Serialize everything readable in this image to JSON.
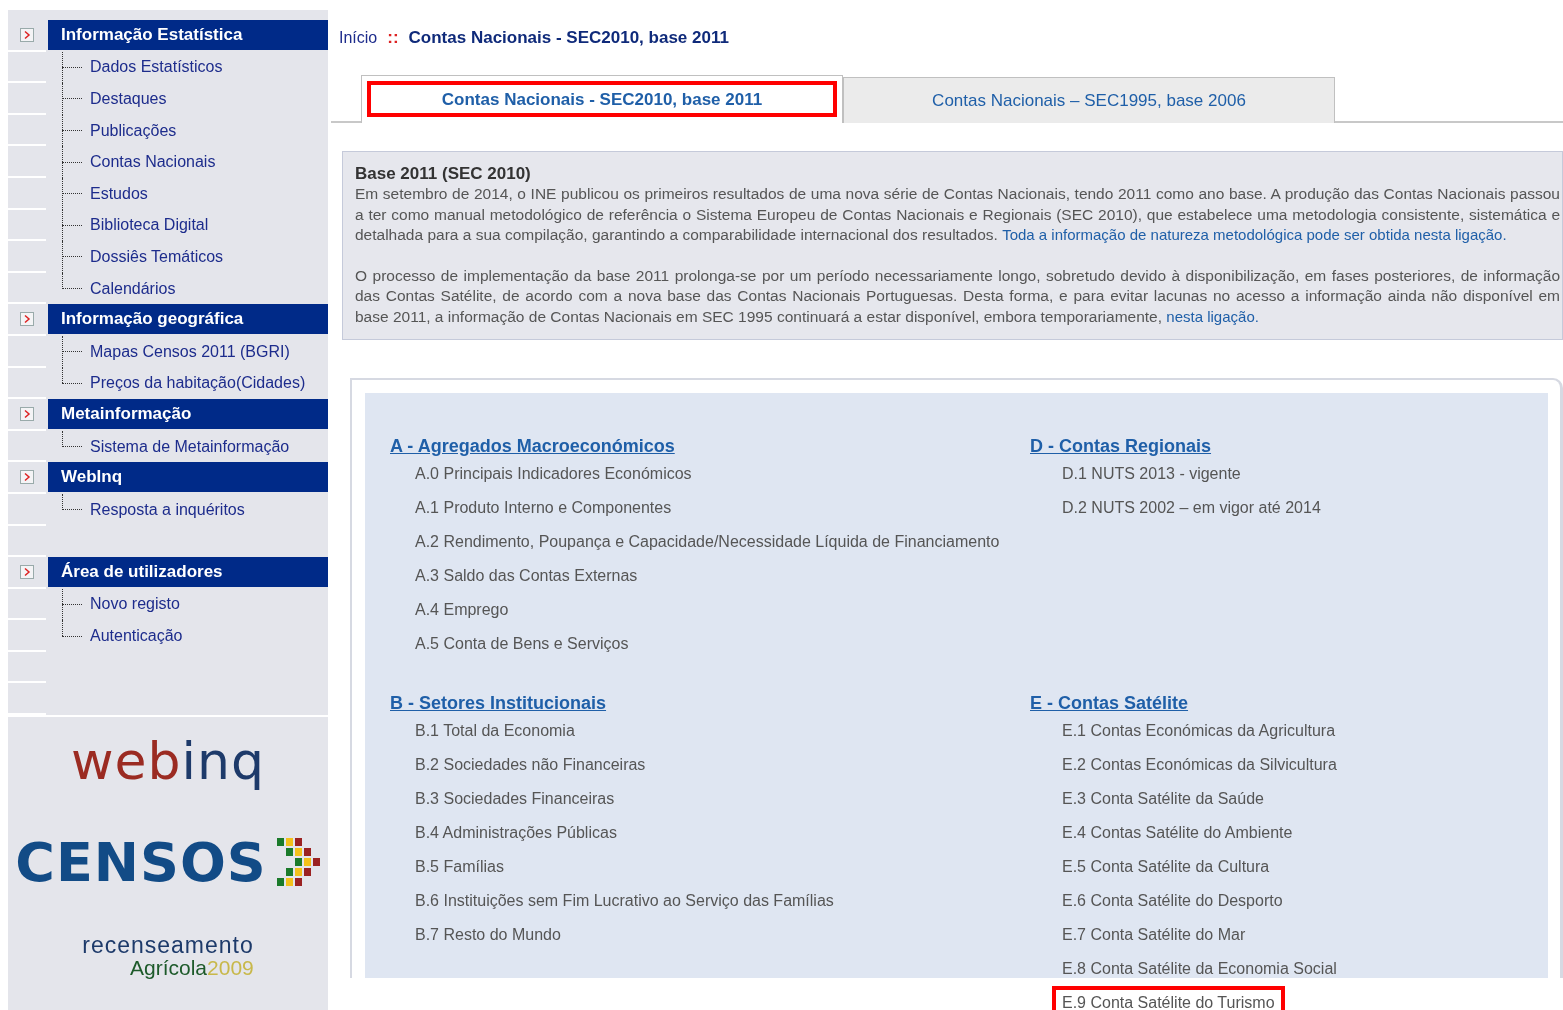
{
  "sidebar": {
    "groups": [
      {
        "title": "Informação Estatística",
        "items": [
          "Dados Estatísticos",
          "Destaques",
          "Publicações",
          "Contas Nacionais",
          "Estudos",
          "Biblioteca Digital",
          "Dossiês Temáticos",
          "Calendários"
        ]
      },
      {
        "title": "Informação geográfica",
        "items": [
          "Mapas Censos 2011 (BGRI)",
          "Preços da habitação(Cidades)"
        ]
      },
      {
        "title": "Metainformação",
        "items": [
          "Sistema de Metainformação"
        ]
      },
      {
        "title": "WebInq",
        "items": [
          "Resposta a inquéritos"
        ]
      },
      {
        "title": "Área de utilizadores",
        "items": [
          "Novo registo",
          "Autenticação"
        ]
      }
    ],
    "logos": [
      {
        "kind": "webinq",
        "parts": [
          "web",
          "inq"
        ]
      },
      {
        "kind": "censos",
        "parts": [
          "CENSOS"
        ]
      },
      {
        "kind": "agricola",
        "parts": [
          "recenseamento",
          "Agrícola",
          "2009"
        ]
      }
    ]
  },
  "breadcrumb": {
    "home": "Início",
    "separator": "::",
    "current": "Contas Nacionais - SEC2010, base 2011"
  },
  "tabs": [
    {
      "label": "Contas Nacionais - SEC2010, base 2011",
      "selected": true,
      "highlighted": true
    },
    {
      "label": "Contas Nacionais – SEC1995, base 2006",
      "selected": false,
      "highlighted": false
    }
  ],
  "intro": {
    "title": "Base 2011 (SEC 2010)",
    "paragraphs": [
      {
        "text": "Em setembro de 2014, o INE publicou os primeiros resultados de uma nova série de Contas Nacionais, tendo 2011 como ano base. A produção das Contas Nacionais passou a ter como manual metodológico de referência o Sistema Europeu de Contas Nacionais e Regionais (SEC 2010), que estabelece uma metodologia consistente, sistemática e detalhada para a sua compilação, garantindo a comparabilidade internacional dos resultados.",
        "link": "Toda a informação de natureza metodológica pode ser obtida nesta ligação."
      },
      {
        "text": "O processo de implementação da base 2011 prolonga-se por um período necessariamente longo, sobretudo devido à disponibilização, em fases posteriores, de informação das Contas Satélite, de acordo com a nova base das Contas Nacionais Portuguesas. Desta forma, e para evitar lacunas no acesso a informação ainda não disponível em base 2011, a informação de Contas Nacionais em SEC 1995 continuará a estar disponível, embora temporariamente,",
        "link": "nesta ligação."
      }
    ]
  },
  "sections": [
    {
      "title": "A - Agregados Macroeconómicos",
      "items": [
        {
          "label": "A.0 Principais Indicadores Económicos",
          "highlighted": false
        },
        {
          "label": "A.1 Produto Interno e Componentes",
          "highlighted": false
        },
        {
          "label": "A.2 Rendimento, Poupança e Capacidade/Necessidade Líquida de Financiamento",
          "highlighted": false
        },
        {
          "label": "A.3 Saldo das Contas Externas",
          "highlighted": false
        },
        {
          "label": "A.4 Emprego",
          "highlighted": false
        },
        {
          "label": "A.5 Conta de Bens e Serviços",
          "highlighted": false
        }
      ]
    },
    {
      "title": "D - Contas Regionais",
      "items": [
        {
          "label": "D.1 NUTS 2013 - vigente",
          "highlighted": false
        },
        {
          "label": "D.2 NUTS 2002 – em vigor até 2014",
          "highlighted": false
        }
      ]
    },
    {
      "title": "B - Setores Institucionais",
      "items": [
        {
          "label": "B.1 Total da Economia",
          "highlighted": false
        },
        {
          "label": "B.2 Sociedades não Financeiras",
          "highlighted": false
        },
        {
          "label": "B.3 Sociedades Financeiras",
          "highlighted": false
        },
        {
          "label": "B.4 Administrações Públicas",
          "highlighted": false
        },
        {
          "label": "B.5 Famílias",
          "highlighted": false
        },
        {
          "label": "B.6 Instituições sem Fim Lucrativo ao Serviço das Famílias",
          "highlighted": false
        },
        {
          "label": "B.7 Resto do Mundo",
          "highlighted": false
        }
      ]
    },
    {
      "title": "E - Contas Satélite",
      "items": [
        {
          "label": "E.1 Contas Económicas da Agricultura",
          "highlighted": false
        },
        {
          "label": "E.2 Contas Económicas da Silvicultura",
          "highlighted": false
        },
        {
          "label": "E.3 Conta Satélite da Saúde",
          "highlighted": false
        },
        {
          "label": "E.4 Contas Satélite do Ambiente",
          "highlighted": false
        },
        {
          "label": "E.5 Conta Satélite da Cultura",
          "highlighted": false
        },
        {
          "label": "E.6 Conta Satélite do Desporto",
          "highlighted": false
        },
        {
          "label": "E.7 Conta Satélite do Mar",
          "highlighted": false
        },
        {
          "label": "E.8 Conta Satélite da Economia Social",
          "highlighted": false
        },
        {
          "label": "E.9 Conta Satélite do Turismo",
          "highlighted": true
        }
      ]
    }
  ]
}
